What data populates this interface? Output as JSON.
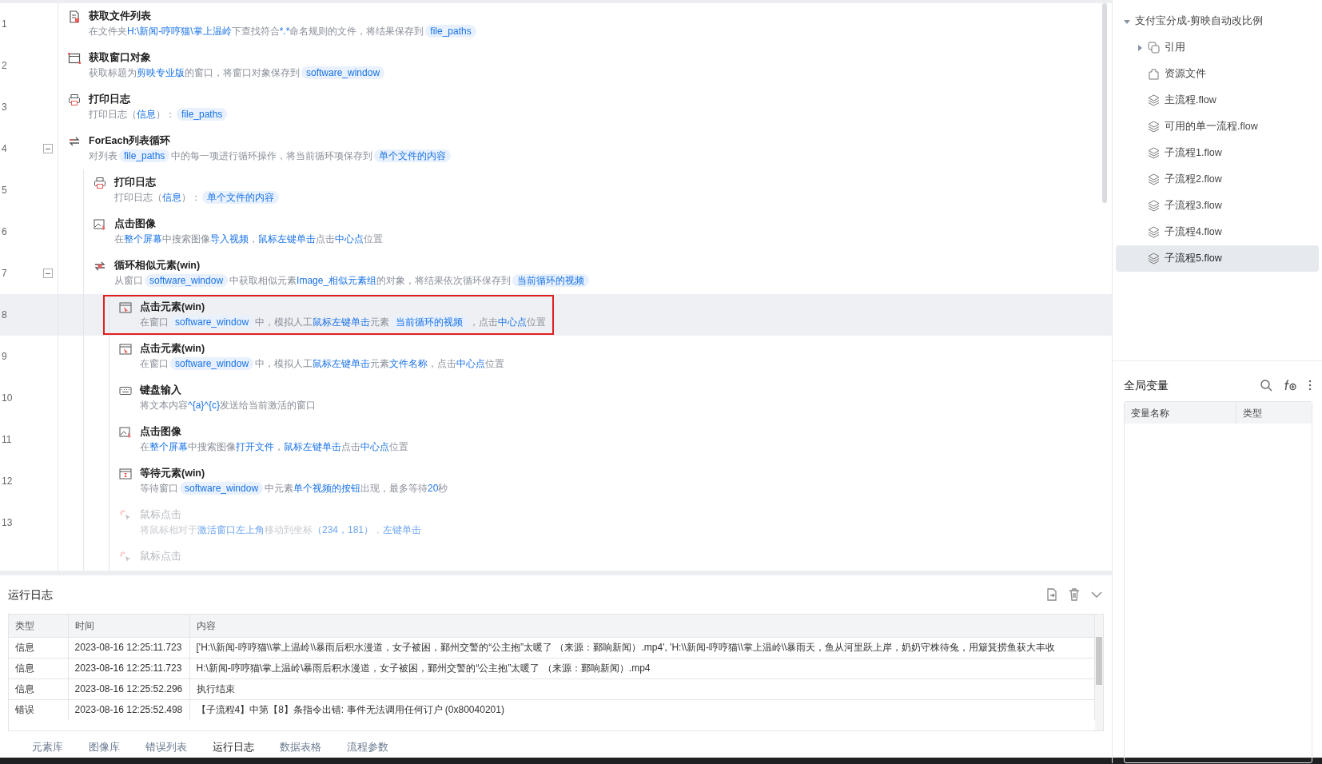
{
  "flow": {
    "steps": [
      {
        "line": "1",
        "kind": "file-list",
        "title": "获取文件列表",
        "disabled": false,
        "selected": false,
        "desc": [
          {
            "kind": "text",
            "text": "在文件夹"
          },
          {
            "kind": "keyword",
            "text": "H:\\新闻-哼哼猫\\掌上温岭"
          },
          {
            "kind": "text",
            "text": "下查找符合"
          },
          {
            "kind": "keyword",
            "text": "*.*"
          },
          {
            "kind": "text",
            "text": "命名规则的文件，将结果保存到"
          },
          {
            "kind": "var",
            "text": "file_paths"
          }
        ]
      },
      {
        "line": "2",
        "kind": "window",
        "title": "获取窗口对象",
        "disabled": false,
        "selected": false,
        "desc": [
          {
            "kind": "text",
            "text": "获取标题为"
          },
          {
            "kind": "keyword",
            "text": "剪映专业版"
          },
          {
            "kind": "text",
            "text": "的窗口，将窗口对象保存到"
          },
          {
            "kind": "var",
            "text": "software_window"
          }
        ]
      },
      {
        "line": "3",
        "kind": "log",
        "title": "打印日志",
        "disabled": false,
        "selected": false,
        "desc": [
          {
            "kind": "text",
            "text": "打印日志（"
          },
          {
            "kind": "keyword",
            "text": "信息"
          },
          {
            "kind": "text",
            "text": "）："
          },
          {
            "kind": "var",
            "text": "file_paths"
          }
        ]
      },
      {
        "line": "4",
        "kind": "foreach",
        "title": "ForEach列表循环",
        "disabled": false,
        "selected": false,
        "expanded": true,
        "desc": [
          {
            "kind": "text",
            "text": "对列表"
          },
          {
            "kind": "var",
            "text": "file_paths"
          },
          {
            "kind": "text",
            "text": "中的每一项进行循环操作，将当前循环项保存到"
          },
          {
            "kind": "var",
            "text": "单个文件的内容"
          }
        ],
        "children": [
          {
            "line": "5",
            "kind": "log",
            "title": "打印日志",
            "disabled": false,
            "selected": false,
            "desc": [
              {
                "kind": "text",
                "text": "打印日志（"
              },
              {
                "kind": "keyword",
                "text": "信息"
              },
              {
                "kind": "text",
                "text": "）："
              },
              {
                "kind": "var",
                "text": "单个文件的内容"
              }
            ]
          },
          {
            "line": "6",
            "kind": "click-image",
            "title": "点击图像",
            "disabled": false,
            "selected": false,
            "desc": [
              {
                "kind": "text",
                "text": "在"
              },
              {
                "kind": "keyword",
                "text": "整个屏幕"
              },
              {
                "kind": "text",
                "text": "中搜索图像"
              },
              {
                "kind": "keyword",
                "text": "导入视频"
              },
              {
                "kind": "text",
                "text": "，"
              },
              {
                "kind": "keyword",
                "text": "鼠标左键单击"
              },
              {
                "kind": "text",
                "text": "点击"
              },
              {
                "kind": "keyword",
                "text": "中心点"
              },
              {
                "kind": "text",
                "text": "位置"
              }
            ]
          },
          {
            "line": "7",
            "kind": "loop-similar",
            "title": "循环相似元素(win)",
            "disabled": false,
            "selected": false,
            "expanded": true,
            "desc": [
              {
                "kind": "text",
                "text": "从窗口"
              },
              {
                "kind": "var",
                "text": "software_window"
              },
              {
                "kind": "text",
                "text": "中获取相似元素"
              },
              {
                "kind": "keyword",
                "text": "Image_相似元素组"
              },
              {
                "kind": "text",
                "text": "的对象，将结果依次循环保存到"
              },
              {
                "kind": "var",
                "text": "当前循环的视频"
              }
            ],
            "children": [
              {
                "line": "8",
                "kind": "click-element",
                "title": "点击元素(win)",
                "disabled": false,
                "selected": true,
                "desc": [
                  {
                    "kind": "text",
                    "text": "在窗口"
                  },
                  {
                    "kind": "var",
                    "text": "software_window"
                  },
                  {
                    "kind": "text",
                    "text": "中，模拟人工"
                  },
                  {
                    "kind": "keyword",
                    "text": "鼠标左键单击"
                  },
                  {
                    "kind": "text",
                    "text": "元素"
                  },
                  {
                    "kind": "var",
                    "text": "当前循环的视频"
                  },
                  {
                    "kind": "text",
                    "text": "，点击"
                  },
                  {
                    "kind": "keyword",
                    "text": "中心点"
                  },
                  {
                    "kind": "text",
                    "text": "位置"
                  }
                ]
              },
              {
                "line": "9",
                "kind": "click-element",
                "title": "点击元素(win)",
                "disabled": false,
                "selected": false,
                "desc": [
                  {
                    "kind": "text",
                    "text": "在窗口"
                  },
                  {
                    "kind": "var",
                    "text": "software_window"
                  },
                  {
                    "kind": "text",
                    "text": "中，模拟人工"
                  },
                  {
                    "kind": "keyword",
                    "text": "鼠标左键单击"
                  },
                  {
                    "kind": "text",
                    "text": "元素"
                  },
                  {
                    "kind": "keyword",
                    "text": "文件名称"
                  },
                  {
                    "kind": "text",
                    "text": "，点击"
                  },
                  {
                    "kind": "keyword",
                    "text": "中心点"
                  },
                  {
                    "kind": "text",
                    "text": "位置"
                  }
                ]
              },
              {
                "line": "10",
                "kind": "keyboard",
                "title": "键盘输入",
                "disabled": false,
                "selected": false,
                "desc": [
                  {
                    "kind": "text",
                    "text": "将文本内容"
                  },
                  {
                    "kind": "keyword",
                    "text": "^{a}^{c}"
                  },
                  {
                    "kind": "text",
                    "text": "发送给当前激活的窗口"
                  }
                ]
              },
              {
                "line": "11",
                "kind": "click-image",
                "title": "点击图像",
                "disabled": false,
                "selected": false,
                "desc": [
                  {
                    "kind": "text",
                    "text": "在"
                  },
                  {
                    "kind": "keyword",
                    "text": "整个屏幕"
                  },
                  {
                    "kind": "text",
                    "text": "中搜索图像"
                  },
                  {
                    "kind": "keyword",
                    "text": "打开文件"
                  },
                  {
                    "kind": "text",
                    "text": "，"
                  },
                  {
                    "kind": "keyword",
                    "text": "鼠标左键单击"
                  },
                  {
                    "kind": "text",
                    "text": "点击"
                  },
                  {
                    "kind": "keyword",
                    "text": "中心点"
                  },
                  {
                    "kind": "text",
                    "text": "位置"
                  }
                ]
              },
              {
                "line": "12",
                "kind": "wait-element",
                "title": "等待元素(win)",
                "disabled": false,
                "selected": false,
                "desc": [
                  {
                    "kind": "text",
                    "text": "等待窗口"
                  },
                  {
                    "kind": "var",
                    "text": "software_window"
                  },
                  {
                    "kind": "text",
                    "text": "中元素"
                  },
                  {
                    "kind": "keyword",
                    "text": "单个视频的按钮"
                  },
                  {
                    "kind": "text",
                    "text": "出现，最多等待"
                  },
                  {
                    "kind": "keyword",
                    "text": "20"
                  },
                  {
                    "kind": "text",
                    "text": "秒"
                  }
                ]
              },
              {
                "line": "13",
                "kind": "mouse-click",
                "title": "鼠标点击",
                "disabled": true,
                "selected": false,
                "desc": [
                  {
                    "kind": "text",
                    "text": "将鼠标相对于"
                  },
                  {
                    "kind": "keyword",
                    "text": "激活窗口左上角"
                  },
                  {
                    "kind": "text",
                    "text": "移动到坐标"
                  },
                  {
                    "kind": "keyword",
                    "text": "（234，181）"
                  },
                  {
                    "kind": "text",
                    "text": "，"
                  },
                  {
                    "kind": "keyword",
                    "text": "左键单击"
                  }
                ]
              },
              {
                "kind": "mouse-click",
                "title": "鼠标点击",
                "disabled": true,
                "selected": false
              }
            ]
          }
        ]
      }
    ]
  },
  "log_panel": {
    "title": "运行日志",
    "columns": [
      "类型",
      "时间",
      "内容"
    ],
    "rows": [
      {
        "type": "信息",
        "time": "2023-08-16 12:25:11.723",
        "content": "['H:\\\\新闻-哼哼猫\\\\掌上温岭\\\\暴雨后积水漫道，女子被困，鄞州交警的“公主抱”太暖了 （来源：鄞响新闻）.mp4', 'H:\\\\新闻-哼哼猫\\\\掌上温岭\\\\暴雨天，鱼从河里跃上岸，奶奶守株待兔，用簸箕捞鱼获大丰收"
      },
      {
        "type": "信息",
        "time": "2023-08-16 12:25:11.723",
        "content": "H:\\新闻-哼哼猫\\掌上温岭\\暴雨后积水漫道，女子被困，鄞州交警的“公主抱”太暖了 （来源：鄞响新闻）.mp4"
      },
      {
        "type": "信息",
        "time": "2023-08-16 12:25:52.296",
        "content": "执行结束"
      },
      {
        "type": "错误",
        "time": "2023-08-16 12:25:52.498",
        "content": "【子流程4】中第【8】条指令出错: 事件无法调用任何订户 (0x80040201)"
      }
    ]
  },
  "bottom_tabs": [
    {
      "label": "元素库",
      "selected": false
    },
    {
      "label": "图像库",
      "selected": false
    },
    {
      "label": "错误列表",
      "selected": false
    },
    {
      "label": "运行日志",
      "selected": true
    },
    {
      "label": "数据表格",
      "selected": false
    },
    {
      "label": "流程参数",
      "selected": false
    }
  ],
  "project_tree": {
    "label": "支付宝分成-剪映自动改比例",
    "expanded": true,
    "children": [
      {
        "label": "引用",
        "kind": "reference",
        "expanded": false,
        "selected": false
      },
      {
        "label": "资源文件",
        "kind": "resource",
        "selected": false
      },
      {
        "label": "主流程.flow",
        "kind": "flow",
        "selected": false
      },
      {
        "label": "可用的单一流程.flow",
        "kind": "flow",
        "selected": false
      },
      {
        "label": "子流程1.flow",
        "kind": "flow",
        "selected": false
      },
      {
        "label": "子流程2.flow",
        "kind": "flow",
        "selected": false
      },
      {
        "label": "子流程3.flow",
        "kind": "flow",
        "selected": false
      },
      {
        "label": "子流程4.flow",
        "kind": "flow",
        "selected": false
      },
      {
        "label": "子流程5.flow",
        "kind": "flow",
        "selected": true
      }
    ]
  },
  "global_variables": {
    "title": "全局变量",
    "columns": [
      "变量名称",
      "类型"
    ]
  }
}
